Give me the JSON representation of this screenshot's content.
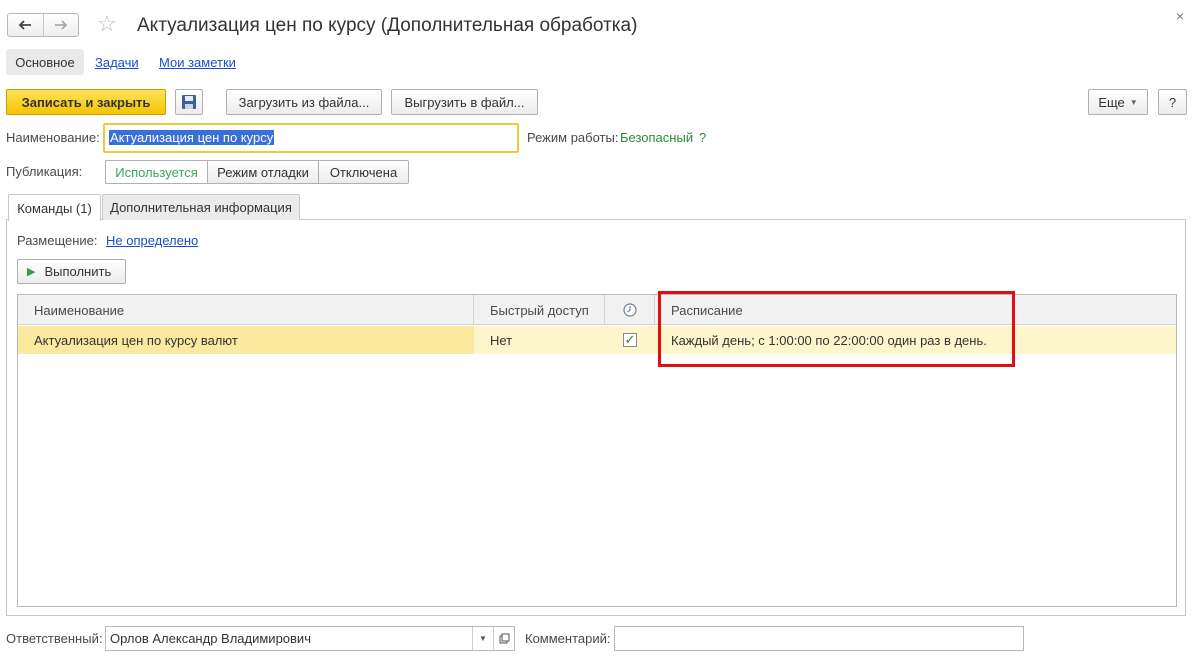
{
  "window": {
    "title": "Актуализация цен по курсу (Дополнительная обработка)",
    "close_glyph": "×"
  },
  "top_tabs": [
    "Основное",
    "Задачи",
    "Мои заметки"
  ],
  "toolbar": {
    "save_close": "Записать и закрыть",
    "load_file": "Загрузить из файла...",
    "unload_file": "Выгрузить в файл...",
    "more": "Еще",
    "help": "?"
  },
  "form": {
    "name_label": "Наименование:",
    "name_value": "Актуализация цен по курсу",
    "mode_label": "Режим работы:",
    "mode_value": "Безопасный",
    "mode_help": "?",
    "publication_label": "Публикация:",
    "publication_options": [
      "Используется",
      "Режим отладки",
      "Отключена"
    ]
  },
  "tabs": [
    "Команды (1)",
    "Дополнительная информация"
  ],
  "commands": {
    "placement_label": "Размещение:",
    "placement_value": "Не определено",
    "execute_label": "Выполнить",
    "columns": [
      "Наименование",
      "Быстрый доступ",
      "",
      "Расписание"
    ],
    "rows": [
      {
        "name": "Актуализация цен по курсу валют",
        "quick_access": "Нет",
        "scheduled": true,
        "schedule": "Каждый день; с 1:00:00 по 22:00:00 один раз в день."
      }
    ]
  },
  "footer": {
    "responsible_label": "Ответственный:",
    "responsible_value": "Орлов Александр Владимирович",
    "comment_label": "Комментарий:",
    "comment_value": ""
  },
  "colors": {
    "accent_yellow": "#f5c400",
    "highlight_red": "#e01010",
    "link_blue": "#1a4ec8",
    "active_green": "#3aa55a"
  }
}
